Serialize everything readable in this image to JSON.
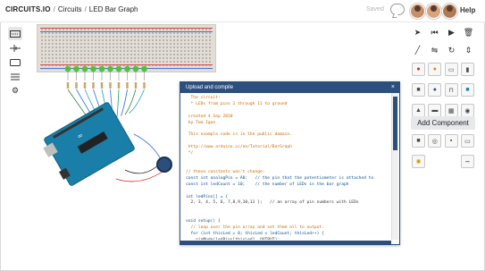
{
  "header": {
    "brand": "CIRCUITS.IO",
    "crumb1": "Circuits",
    "crumb2": "LED Bar Graph",
    "saved": "Saved",
    "help": "Help"
  },
  "left_tools": [
    "breadboard-icon",
    "schematic-icon",
    "pcb-icon",
    "list-icon",
    "settings-icon"
  ],
  "right_panel": {
    "add_component": "Add Component"
  },
  "code_panel": {
    "title": "Upload and compile",
    "close": "×",
    "lines": [
      {
        "t": "  The circuit:",
        "k": "c"
      },
      {
        "t": "  * LEDs from pins 2 through 11 to ground",
        "k": "c"
      },
      {
        "t": "",
        "k": ""
      },
      {
        "t": " created 4 Sep 2010",
        "k": "c"
      },
      {
        "t": " by Tom Igoe",
        "k": "c"
      },
      {
        "t": "",
        "k": ""
      },
      {
        "t": " This example code is in the public domain.",
        "k": "c"
      },
      {
        "t": "",
        "k": ""
      },
      {
        "t": " http://www.arduino.cc/en/Tutorial/BarGraph",
        "k": "c"
      },
      {
        "t": " */",
        "k": "c"
      },
      {
        "t": "",
        "k": ""
      },
      {
        "t": "",
        "k": ""
      },
      {
        "t": "// these constants won't change:",
        "k": "c"
      },
      {
        "t": "const int analogPin = A0;   // the pin that the potentiometer is attached to",
        "k": "k"
      },
      {
        "t": "const int ledCount = 10;    // the number of LEDs in the bar graph",
        "k": "k"
      },
      {
        "t": "",
        "k": ""
      },
      {
        "t": "int ledPins[] = {",
        "k": "k"
      },
      {
        "t": "  2, 3, 4, 5, 6, 7,8,9,10,11 };   // an array of pin numbers with LEDs",
        "k": ""
      },
      {
        "t": "",
        "k": ""
      },
      {
        "t": "",
        "k": ""
      },
      {
        "t": "void setup() {",
        "k": "k"
      },
      {
        "t": "  // loop over the pin array and set them all to output:",
        "k": "c"
      },
      {
        "t": "  for (int thisLed = 0; thisLed < ledCount; thisLed++) {",
        "k": "k"
      },
      {
        "t": "    pinMode(ledPins[thisLed], OUTPUT);",
        "k": ""
      },
      {
        "t": "  }",
        "k": ""
      },
      {
        "t": "}",
        "k": ""
      }
    ]
  },
  "colors": {
    "accent": "#2c4f7d",
    "arduino": "#197fa8",
    "led": "#4fc23a"
  }
}
